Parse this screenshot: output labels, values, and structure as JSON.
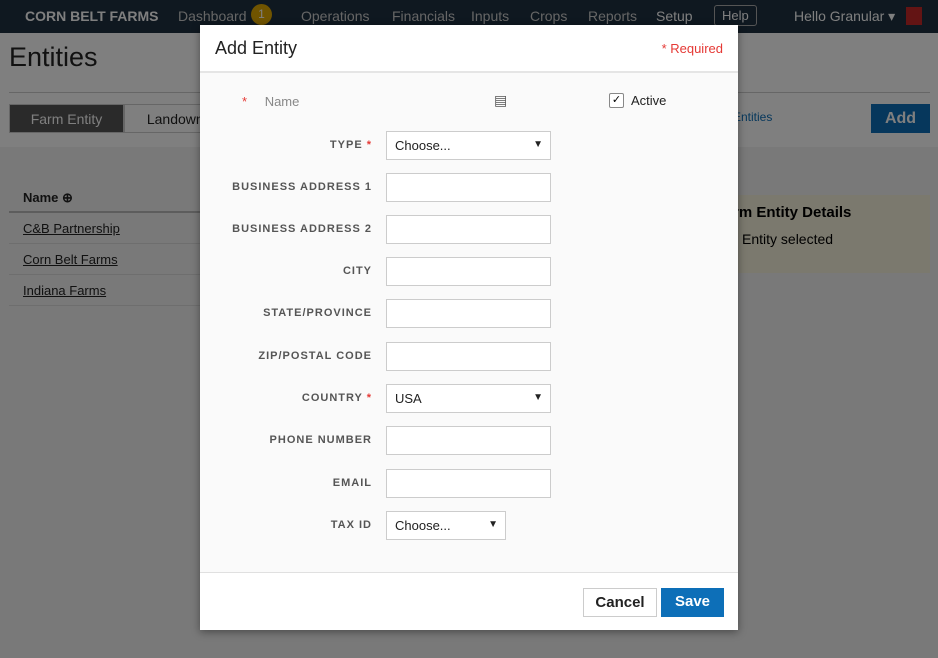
{
  "nav": {
    "brand": "CORN BELT FARMS",
    "items": [
      "Dashboard",
      "Operations",
      "Financials",
      "Inputs",
      "Crops",
      "Reports",
      "Setup"
    ],
    "badge": "1",
    "help": "Help",
    "user": "Hello Granular"
  },
  "page": {
    "title": "Entities",
    "tabs": [
      "Farm Entity",
      "Landowner"
    ],
    "entities_link": "Entities",
    "add": "Add",
    "list_header": "Name",
    "rows": [
      "C&B Partnership",
      "Corn Belt Farms",
      "Indiana Farms"
    ],
    "details_title": "rm Entity Details",
    "details_text": "Entity selected"
  },
  "modal": {
    "title": "Add Entity",
    "required": "* Required",
    "name_placeholder": "Name",
    "active_label": "Active",
    "active_checked": true,
    "fields": [
      {
        "label": "TYPE",
        "required": true,
        "type": "select",
        "value": "Choose..."
      },
      {
        "label": "BUSINESS ADDRESS 1",
        "value": ""
      },
      {
        "label": "BUSINESS ADDRESS 2",
        "value": ""
      },
      {
        "label": "CITY",
        "value": ""
      },
      {
        "label": "STATE/PROVINCE",
        "value": ""
      },
      {
        "label": "ZIP/POSTAL CODE",
        "value": ""
      },
      {
        "label": "COUNTRY",
        "required": true,
        "type": "select",
        "value": "USA"
      },
      {
        "label": "PHONE NUMBER",
        "value": ""
      },
      {
        "label": "EMAIL",
        "value": ""
      },
      {
        "label": "TAX ID",
        "type": "select",
        "value": "Choose..."
      }
    ],
    "cancel": "Cancel",
    "save": "Save"
  },
  "colors": {
    "accent": "#0d6fb8",
    "required": "#e53935",
    "nav": "#1f3140"
  }
}
